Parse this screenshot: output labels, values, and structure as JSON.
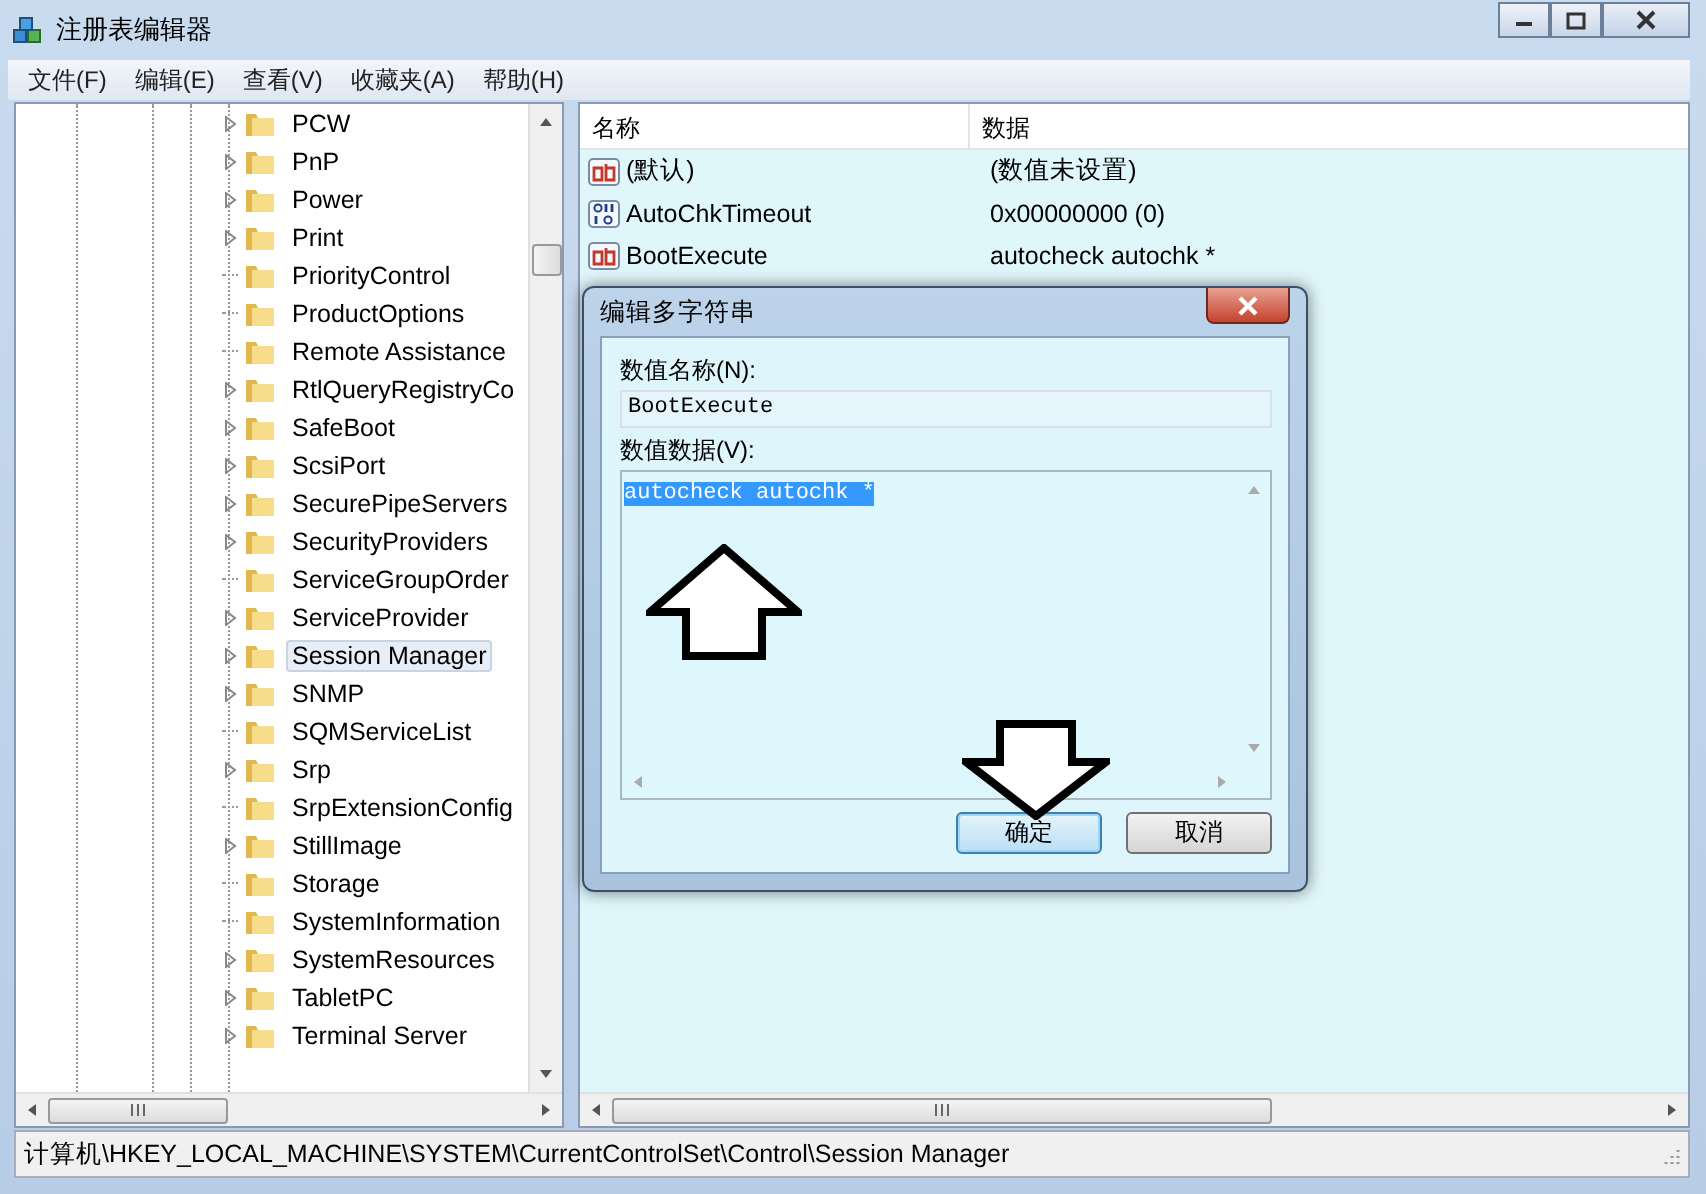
{
  "window": {
    "title": "注册表编辑器"
  },
  "menu": [
    "文件(F)",
    "编辑(E)",
    "查看(V)",
    "收藏夹(A)",
    "帮助(H)"
  ],
  "tree": {
    "items": [
      {
        "label": "PCW",
        "expandable": true,
        "selected": false
      },
      {
        "label": "PnP",
        "expandable": true,
        "selected": false
      },
      {
        "label": "Power",
        "expandable": true,
        "selected": false
      },
      {
        "label": "Print",
        "expandable": true,
        "selected": false
      },
      {
        "label": "PriorityControl",
        "expandable": false,
        "selected": false
      },
      {
        "label": "ProductOptions",
        "expandable": false,
        "selected": false
      },
      {
        "label": "Remote Assistance",
        "expandable": false,
        "selected": false
      },
      {
        "label": "RtlQueryRegistryCo",
        "expandable": true,
        "selected": false
      },
      {
        "label": "SafeBoot",
        "expandable": true,
        "selected": false
      },
      {
        "label": "ScsiPort",
        "expandable": true,
        "selected": false
      },
      {
        "label": "SecurePipeServers",
        "expandable": true,
        "selected": false
      },
      {
        "label": "SecurityProviders",
        "expandable": true,
        "selected": false
      },
      {
        "label": "ServiceGroupOrder",
        "expandable": false,
        "selected": false
      },
      {
        "label": "ServiceProvider",
        "expandable": true,
        "selected": false
      },
      {
        "label": "Session Manager",
        "expandable": true,
        "selected": true
      },
      {
        "label": "SNMP",
        "expandable": true,
        "selected": false
      },
      {
        "label": "SQMServiceList",
        "expandable": false,
        "selected": false
      },
      {
        "label": "Srp",
        "expandable": true,
        "selected": false
      },
      {
        "label": "SrpExtensionConfig",
        "expandable": false,
        "selected": false
      },
      {
        "label": "StillImage",
        "expandable": true,
        "selected": false
      },
      {
        "label": "Storage",
        "expandable": false,
        "selected": false
      },
      {
        "label": "SystemInformation",
        "expandable": false,
        "selected": false
      },
      {
        "label": "SystemResources",
        "expandable": true,
        "selected": false
      },
      {
        "label": "TabletPC",
        "expandable": true,
        "selected": false
      },
      {
        "label": "Terminal Server",
        "expandable": true,
        "selected": false
      }
    ]
  },
  "values": {
    "columns": [
      "名称",
      "数据"
    ],
    "rows": [
      {
        "kind": "string",
        "name": "(默认)",
        "data": "(数值未设置)"
      },
      {
        "kind": "number",
        "name": "AutoChkTimeout",
        "data": "0x00000000 (0)"
      },
      {
        "kind": "string",
        "name": "BootExecute",
        "data": "autocheck autochk *"
      }
    ]
  },
  "dialog": {
    "title": "编辑多字符串",
    "name_label": "数值名称(N):",
    "name_value": "BootExecute",
    "data_label": "数值数据(V):",
    "data_value": "autocheck autochk *",
    "data_selected": true,
    "buttons": [
      {
        "label": "确定",
        "default": true
      },
      {
        "label": "取消",
        "default": false
      }
    ]
  },
  "status_bar": "计算机\\HKEY_LOCAL_MACHINE\\SYSTEM\\CurrentControlSet\\Control\\Session Manager"
}
